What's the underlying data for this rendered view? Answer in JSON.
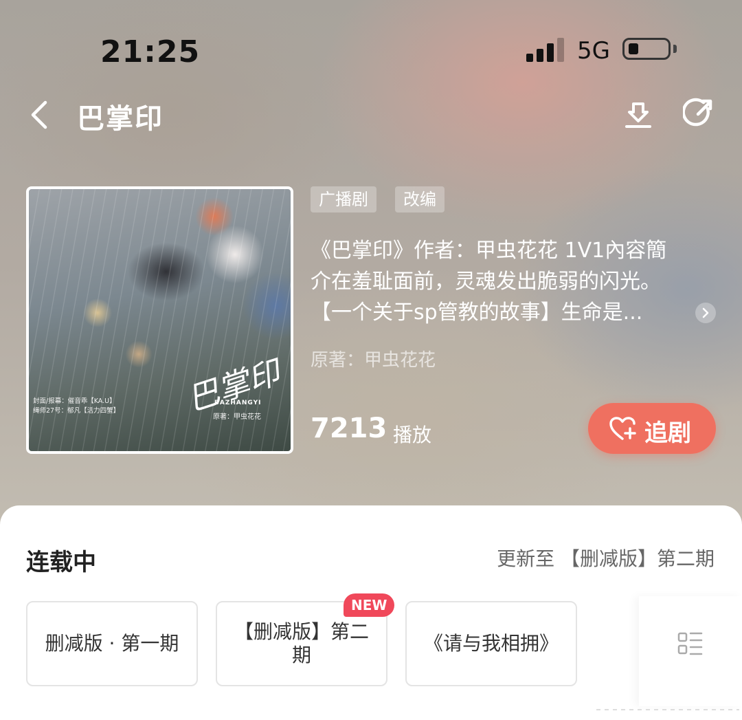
{
  "status_bar": {
    "time": "21:25",
    "network": "5G",
    "signal_bars": 3,
    "battery_level": 0.2
  },
  "nav": {
    "title": "巴掌印"
  },
  "cover": {
    "logo_text": "巴掌印",
    "logo_sub": "BAZHANGYI",
    "credits_1": "封面/报幕：催音乖【KA.U】",
    "credits_2": "绳师27号：郁凡【活力四蟹】",
    "author_text": "原著：甲虫花花"
  },
  "tags": [
    "广播剧",
    "改编"
  ],
  "description": {
    "line1": "《巴掌印》作者：甲虫花花  1V1內容簡",
    "line2": "介在羞耻面前，灵魂发出脆弱的闪光。",
    "line3": "【一个关于sp管教的故事】生命是..."
  },
  "original_author": "原著：甲虫花花",
  "stats": {
    "play_count": "7213",
    "play_label": "播放"
  },
  "follow_button": {
    "label": "追剧"
  },
  "episodes_section": {
    "title": "连载中",
    "update_text": "更新至 【删减版】第二期",
    "episodes": [
      {
        "label": "删减版 · 第一期"
      },
      {
        "label": "【删减版】第二期",
        "badge": "NEW"
      },
      {
        "label": "《请与我相拥》"
      }
    ]
  },
  "colors": {
    "accent": "#ef7060",
    "new_badge": "#f0485a"
  }
}
